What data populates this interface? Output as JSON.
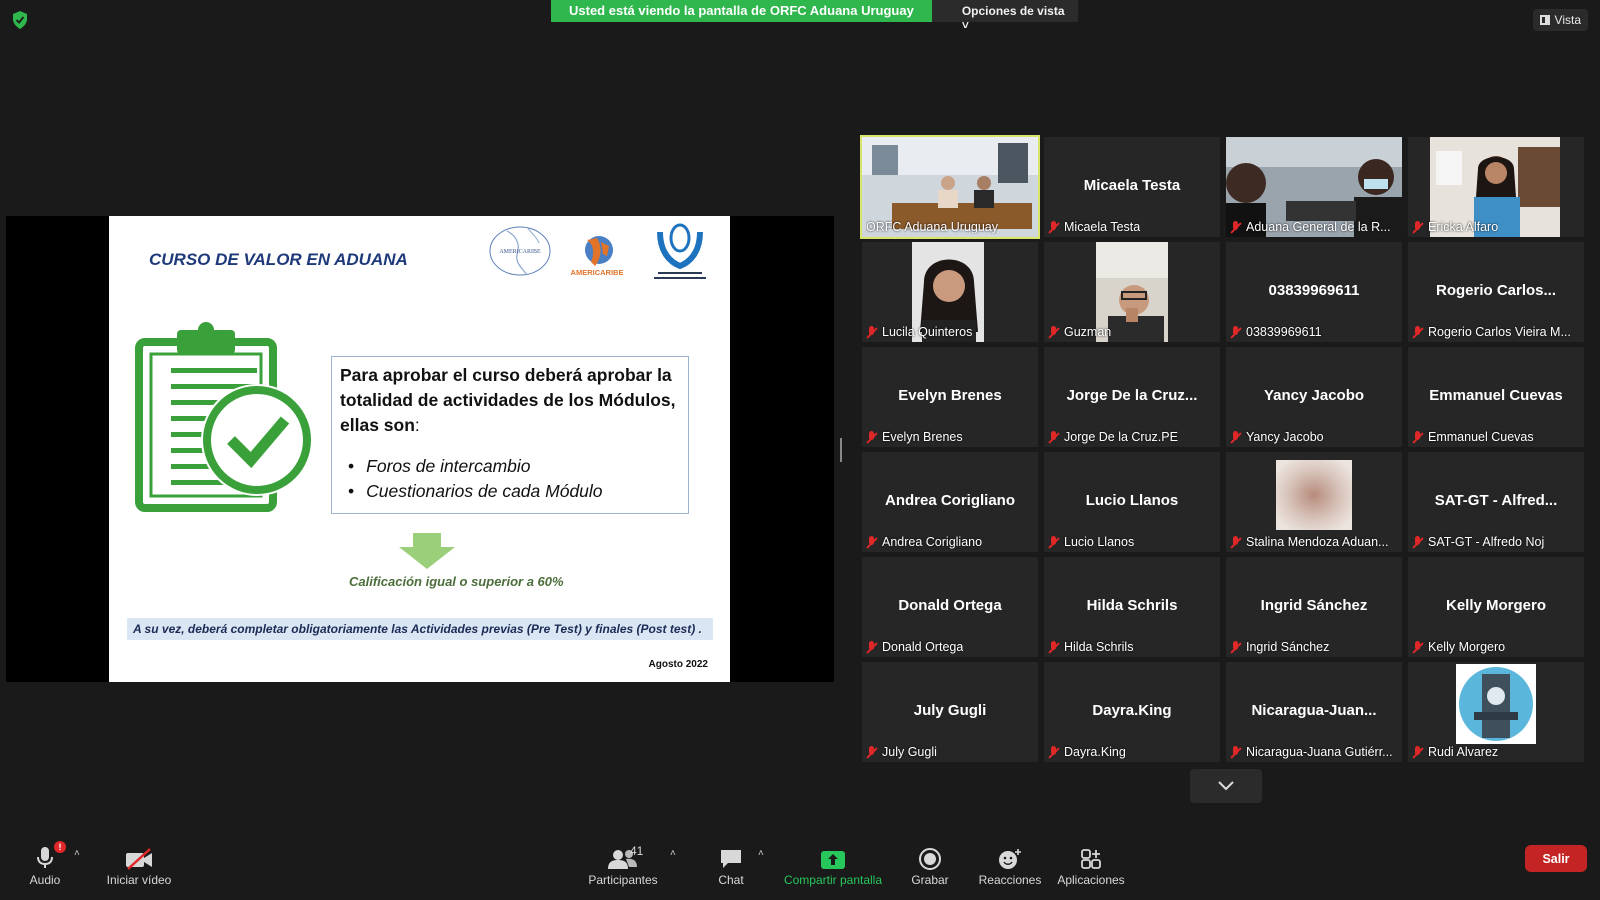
{
  "banner": {
    "viewing_text": "Usted está viendo la pantalla de ORFC Aduana Uruguay",
    "view_options_label": "Opciones de vista"
  },
  "view_button_label": "Vista",
  "slide": {
    "title": "CURSO DE VALOR EN ADUANA",
    "logo_americaribe_text": "AMERICARIBE",
    "logo_caribe_text": "AMERICARIBE",
    "box_paragraph": "Para aprobar el curso deberá aprobar la totalidad de actividades de los Módulos, ellas son",
    "box_colon": ":",
    "bullets": [
      "Foros de intercambio",
      "Cuestionarios de cada Módulo"
    ],
    "grade_text": "Calificación igual o superior a 60%",
    "note_text": "A su vez, deberá completar obligatoriamente las Actividades previas (Pre Test) y finales (Post test) .",
    "date_text": "Agosto 2022",
    "colors": {
      "title": "#1f3a7a",
      "green": "#3aa13a",
      "arrow": "#9ccf7a"
    }
  },
  "gallery": {
    "tiles": [
      {
        "label": "ORFC Aduana Uruguay",
        "center": "",
        "video": "room",
        "muted": false,
        "active": true
      },
      {
        "label": "Micaela Testa",
        "center": "Micaela Testa",
        "video": "",
        "muted": true,
        "active": false
      },
      {
        "label": "Aduana General de la R...",
        "center": "",
        "video": "two-people",
        "muted": true,
        "active": false
      },
      {
        "label": "Ericka Alfaro",
        "center": "",
        "video": "woman-office",
        "muted": true,
        "active": false
      },
      {
        "label": "Lucila Quinteros",
        "center": "",
        "video": "woman",
        "muted": true,
        "active": false
      },
      {
        "label": "Guzman",
        "center": "",
        "video": "man",
        "muted": true,
        "active": false
      },
      {
        "label": "03839969611",
        "center": "03839969611",
        "video": "",
        "muted": true,
        "active": false
      },
      {
        "label": "Rogerio Carlos Vieira M...",
        "center": "Rogerio  Carlos...",
        "video": "",
        "muted": true,
        "active": false
      },
      {
        "label": "Evelyn Brenes",
        "center": "Evelyn Brenes",
        "video": "",
        "muted": true,
        "active": false
      },
      {
        "label": "Jorge De la Cruz.PE",
        "center": "Jorge De la Cruz...",
        "video": "",
        "muted": true,
        "active": false
      },
      {
        "label": "Yancy Jacobo",
        "center": "Yancy Jacobo",
        "video": "",
        "muted": true,
        "active": false
      },
      {
        "label": "Emmanuel Cuevas",
        "center": "Emmanuel Cuevas",
        "video": "",
        "muted": true,
        "active": false
      },
      {
        "label": "Andrea Corigliano",
        "center": "Andrea Corigliano",
        "video": "",
        "muted": true,
        "active": false
      },
      {
        "label": "Lucio Llanos",
        "center": "Lucio Llanos",
        "video": "",
        "muted": true,
        "active": false
      },
      {
        "label": "Stalina Mendoza Aduan...",
        "center": "",
        "video": "blurred",
        "muted": true,
        "active": false
      },
      {
        "label": "SAT-GT - Alfredo Noj",
        "center": "SAT-GT - Alfred...",
        "video": "",
        "muted": true,
        "active": false
      },
      {
        "label": "Donald Ortega",
        "center": "Donald Ortega",
        "video": "",
        "muted": true,
        "active": false
      },
      {
        "label": "Hilda Schrils",
        "center": "Hilda Schrils",
        "video": "",
        "muted": true,
        "active": false
      },
      {
        "label": "Ingrid Sánchez",
        "center": "Ingrid Sánchez",
        "video": "",
        "muted": true,
        "active": false
      },
      {
        "label": "Kelly Morgero",
        "center": "Kelly Morgero",
        "video": "",
        "muted": true,
        "active": false
      },
      {
        "label": "July Gugli",
        "center": "July Gugli",
        "video": "",
        "muted": true,
        "active": false
      },
      {
        "label": "Dayra.King",
        "center": "Dayra.King",
        "video": "",
        "muted": true,
        "active": false
      },
      {
        "label": "Nicaragua-Juana Gutiérr...",
        "center": "Nicaragua-Juan...",
        "video": "",
        "muted": true,
        "active": false
      },
      {
        "label": "Rudi Alvarez",
        "center": "",
        "video": "tower",
        "muted": true,
        "active": false
      }
    ]
  },
  "toolbar": {
    "audio_label": "Audio",
    "audio_badge": "!",
    "video_label": "Iniciar vídeo",
    "participants_label": "Participantes",
    "participants_count": "41",
    "chat_label": "Chat",
    "share_label": "Compartir pantalla",
    "record_label": "Grabar",
    "reactions_label": "Reacciones",
    "apps_label": "Aplicaciones",
    "leave_label": "Salir",
    "share_color": "#28c75c",
    "leave_color": "#c42424"
  }
}
